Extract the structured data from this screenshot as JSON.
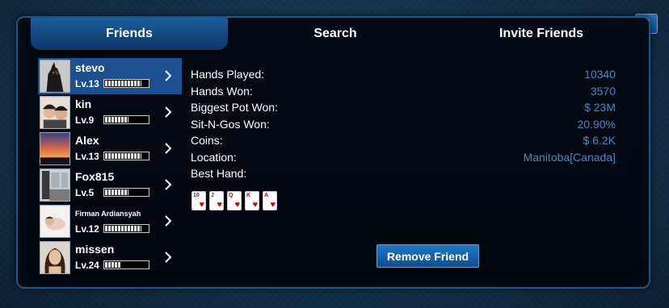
{
  "tabs": {
    "friends": "Friends",
    "search": "Search",
    "invite": "Invite Friends"
  },
  "back_icon": "chevron-left-icon",
  "friends": [
    {
      "name": "stevo",
      "level": "Lv.13",
      "level_progress": 0.85,
      "selected": true
    },
    {
      "name": "kin",
      "level": "Lv.9",
      "level_progress": 0.55,
      "selected": false
    },
    {
      "name": "Alex",
      "level": "Lv.13",
      "level_progress": 0.85,
      "selected": false
    },
    {
      "name": "Fox815",
      "level": "Lv.5",
      "level_progress": 0.55,
      "selected": false
    },
    {
      "name": "Firman Ardiansyah",
      "level": "Lv.12",
      "level_progress": 0.85,
      "selected": false
    },
    {
      "name": "missen",
      "level": "Lv.24",
      "level_progress": 0.35,
      "selected": false
    }
  ],
  "stats": [
    {
      "label": "Hands Played:",
      "value": "10340"
    },
    {
      "label": "Hands Won:",
      "value": "3570"
    },
    {
      "label": "Biggest Pot Won:",
      "value": "$ 23M"
    },
    {
      "label": "Sit-N-Gos Won:",
      "value": "20.90%"
    },
    {
      "label": "Coins:",
      "value": "$ 6.2K"
    },
    {
      "label": "Location:",
      "value": "Manitoba[Canada]"
    },
    {
      "label": "Best Hand:",
      "value": ""
    }
  ],
  "best_hand": [
    {
      "rank": "10",
      "suit": "♥"
    },
    {
      "rank": "J",
      "suit": "♥"
    },
    {
      "rank": "Q",
      "suit": "♥"
    },
    {
      "rank": "K",
      "suit": "♥"
    },
    {
      "rank": "A",
      "suit": "♥"
    }
  ],
  "remove_button": "Remove Friend",
  "colors": {
    "accent": "#1b5d9a",
    "selected_row": "#1b4f8e",
    "stat_value": "#4a87c4",
    "card_red": "#d40000"
  }
}
